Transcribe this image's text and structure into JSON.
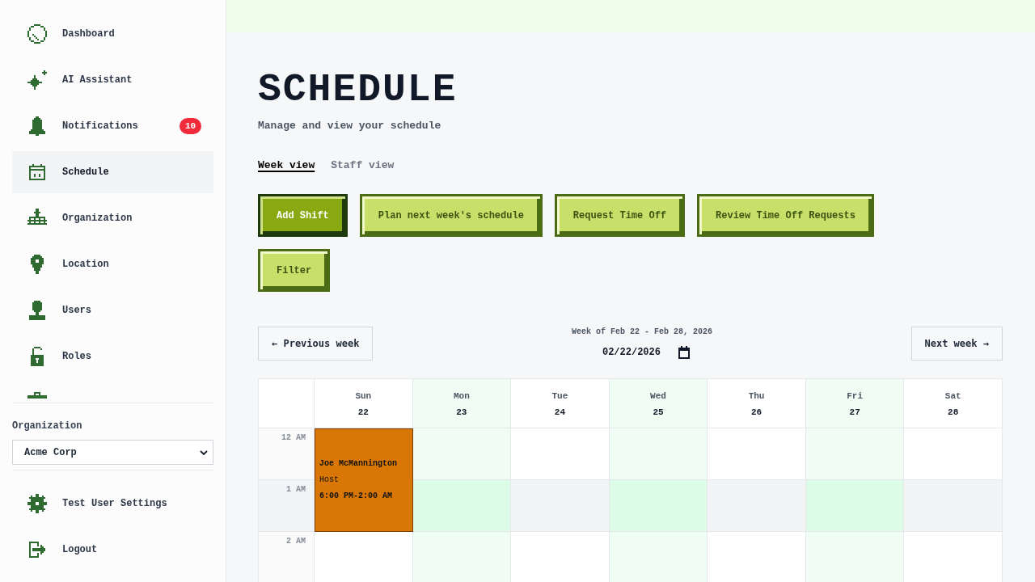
{
  "sidebar": {
    "nav_items": [
      {
        "label": "Dashboard",
        "selected": false
      },
      {
        "label": "AI Assistant",
        "selected": false
      },
      {
        "label": "Notifications",
        "selected": false,
        "badge": "10"
      },
      {
        "label": "Schedule",
        "selected": true
      },
      {
        "label": "Organization",
        "selected": false
      },
      {
        "label": "Location",
        "selected": false
      },
      {
        "label": "Users",
        "selected": false
      },
      {
        "label": "Roles",
        "selected": false
      }
    ],
    "organization": {
      "label": "Organization",
      "value": "Acme Corp"
    },
    "account_items": [
      {
        "label": "Test User Settings"
      },
      {
        "label": "Logout"
      }
    ]
  },
  "page": {
    "title": "SCHEDULE",
    "subtitle": "Manage and view your schedule"
  },
  "view_tabs": [
    {
      "label": "Week view",
      "selected": true
    },
    {
      "label": "Staff view",
      "selected": false
    }
  ],
  "action_rows": [
    {
      "buttons": [
        {
          "label": "Add Shift",
          "kind": "primary"
        },
        {
          "label": "Plan next week's schedule",
          "kind": "secondary"
        },
        {
          "label": "Request Time Off",
          "kind": "secondary"
        },
        {
          "label": "Review Time Off Requests",
          "kind": "secondary"
        }
      ]
    },
    {
      "buttons": [
        {
          "label": "Filter",
          "kind": "secondary"
        }
      ]
    }
  ],
  "week_nav": {
    "previous": "← Previous week",
    "range": "Week of Feb 22 - Feb 28, 2026",
    "date": "02/22/2026",
    "next": "Next week →"
  },
  "calendar": {
    "days": [
      {
        "name": "Sun",
        "date": "22",
        "highlighted": false,
        "shifts": [
          {
            "name": "Joe McMannington",
            "role": "Host",
            "time": "6:00 PM-2:00 AM",
            "color": "#d97706",
            "covers_hours": [
              true,
              true,
              false
            ]
          }
        ]
      },
      {
        "name": "Mon",
        "date": "23",
        "highlighted": true
      },
      {
        "name": "Tue",
        "date": "24",
        "highlighted": false
      },
      {
        "name": "Wed",
        "date": "25",
        "highlighted": true
      },
      {
        "name": "Thu",
        "date": "26",
        "highlighted": false
      },
      {
        "name": "Fri",
        "date": "27",
        "highlighted": true
      },
      {
        "name": "Sat",
        "date": "28",
        "highlighted": false
      }
    ],
    "hours": [
      {
        "label": "12 AM",
        "shaded": false
      },
      {
        "label": "1 AM",
        "shaded": true
      },
      {
        "label": "2 AM",
        "shaded": false
      }
    ]
  }
}
